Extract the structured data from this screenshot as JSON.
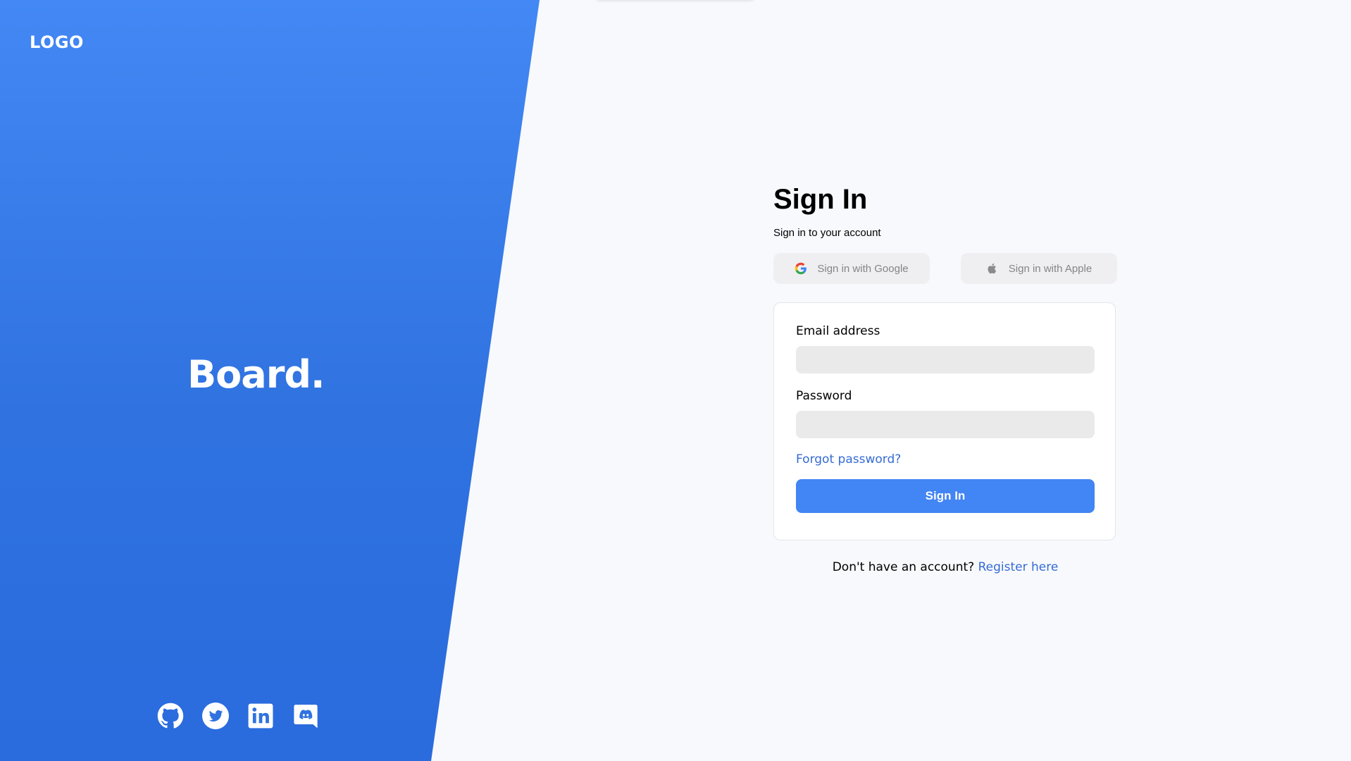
{
  "left": {
    "logo_text": "LOGO",
    "brand_text": "Board.",
    "socials": [
      {
        "icon": "github-icon"
      },
      {
        "icon": "twitter-icon"
      },
      {
        "icon": "linkedin-icon"
      },
      {
        "icon": "discord-icon"
      }
    ],
    "gradient_top": "#4388f4",
    "gradient_bottom": "#2a6bdd"
  },
  "form": {
    "title": "Sign In",
    "subtitle": "Sign in to your account",
    "google_label": "Sign in with Google",
    "apple_label": "Sign in with Apple",
    "email_label": "Email address",
    "email_value": "",
    "password_label": "Password",
    "password_value": "",
    "forgot_label": "Forgot password?",
    "submit_label": "Sign In",
    "register_prompt": "Don't have an account?",
    "register_link": "Register here"
  },
  "colors": {
    "accent": "#4285f4",
    "link": "#346bd4",
    "background": "#f8f9fd"
  }
}
